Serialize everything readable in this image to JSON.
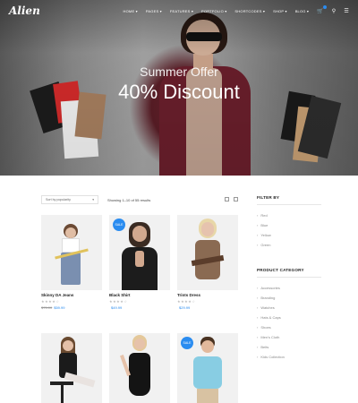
{
  "nav": {
    "logo": "Alien",
    "menu": [
      "HOME ▾",
      "PAGES ▾",
      "FEATURES ▾",
      "PORTFOLIO ▾",
      "SHORTCODES ▾",
      "SHOP ▾",
      "BLOG ▾"
    ],
    "cart_icon": "cart-icon",
    "search_icon": "search-icon",
    "menu_icon": "hamburger-icon"
  },
  "hero": {
    "subtitle": "Summer Offer",
    "title": "40% Discount"
  },
  "shop": {
    "sort_label": "Sort by popularity",
    "results_text": "Showing 1–10 of 55 results",
    "products": [
      {
        "name": "Skinny DA Jeans",
        "stars": "★★★★☆",
        "old_price": "$75.00",
        "price": "$59.99",
        "badge": ""
      },
      {
        "name": "Black Shirt",
        "stars": "★★★★☆",
        "old_price": "",
        "price": "$49.99",
        "badge": "SALE"
      },
      {
        "name": "Trints Dress",
        "stars": "★★★★☆",
        "old_price": "",
        "price": "$29.99",
        "badge": ""
      },
      {
        "name": "",
        "stars": "",
        "old_price": "",
        "price": "",
        "badge": ""
      },
      {
        "name": "",
        "stars": "",
        "old_price": "",
        "price": "",
        "badge": ""
      },
      {
        "name": "",
        "stars": "",
        "old_price": "",
        "price": "",
        "badge": "SALE"
      }
    ]
  },
  "sidebar": {
    "filter_title": "FILTER BY",
    "filters": [
      "Red",
      "Blue",
      "Yellow",
      "Green"
    ],
    "category_title": "PRODUCT CATEGORY",
    "categories": [
      "Accessories",
      "Branding",
      "Watches",
      "Hats & Caps",
      "Shoes",
      "Men's Cloth",
      "Belts",
      "Kids Collection"
    ]
  },
  "colors": {
    "accent": "#2a8cf0"
  }
}
